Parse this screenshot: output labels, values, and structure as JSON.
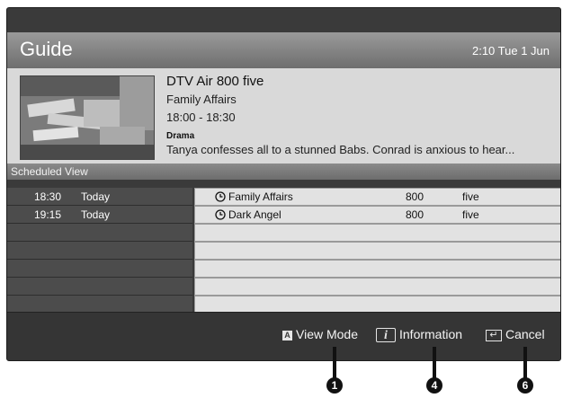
{
  "header": {
    "title": "Guide",
    "clock": "2:10 Tue 1 Jun"
  },
  "program_info": {
    "channel": "DTV Air 800 five",
    "program": "Family Affairs",
    "time": "18:00 - 18:30",
    "genre": "Drama",
    "description": "Tanya confesses all to a stunned Babs. Conrad is anxious to hear..."
  },
  "scheduled_view_label": "Scheduled View",
  "schedule": [
    {
      "time": "18:30",
      "day": "Today",
      "program": "Family Affairs",
      "channel_number": "800",
      "channel_name": "five"
    },
    {
      "time": "19:15",
      "day": "Today",
      "program": "Dark Angel",
      "channel_number": "800",
      "channel_name": "five"
    }
  ],
  "footer": {
    "view_mode": {
      "icon": "A",
      "label": "View Mode"
    },
    "information": {
      "icon": "i",
      "label": "Information"
    },
    "cancel": {
      "label": "Cancel"
    }
  },
  "callouts": [
    "1",
    "4",
    "6"
  ]
}
